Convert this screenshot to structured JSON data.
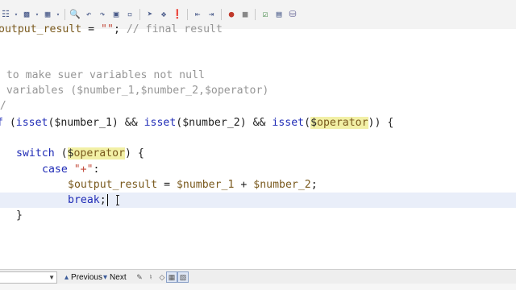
{
  "toolbar": {
    "icons": [
      "open-file-icon",
      "dropdown-icon",
      "save-icon",
      "dropdown-icon",
      "toggle-icon",
      "dropdown-icon",
      "find-icon",
      "find-previous-icon",
      "find-next-icon",
      "find-selection-icon",
      "toggle-bookmark-icon",
      "previous-bookmark-icon",
      "next-bookmark-icon",
      "shift-left-icon",
      "shift-right-icon",
      "start-macro-icon",
      "stop-macro-icon",
      "check-icon",
      "database-icon"
    ]
  },
  "code": {
    "line1": {
      "var": "output_result",
      "op": " = ",
      "str": "\"\"",
      "rest": "; ",
      "comment": "// final result"
    },
    "line3": "/*",
    "line4": " * to make suer variables not null",
    "line5": " * variables ($number_1,$number_2,$operator)",
    "line6": " */",
    "line8": {
      "kw1": "if",
      "p1": " (",
      "fn1": "isset",
      "a1": "($number_1)",
      "and1": " && ",
      "fn2": "isset",
      "a2": "($number_2)",
      "and2": " && ",
      "fn3": "isset",
      "a3o": "(",
      "a3d": "$",
      "a3v": "operator",
      "a3c": "))",
      "brace": " {"
    },
    "line10": {
      "kw": "switch",
      "o": " (",
      "d": "$",
      "v": "operator",
      "c": ") {"
    },
    "line11": {
      "kw": "case",
      "sp": " ",
      "str": "\"+\"",
      "c": ":"
    },
    "line12": {
      "lhs": "$output_result",
      "eq": " = ",
      "a": "$number_1",
      "plus": " + ",
      "b": "$number_2",
      "end": ";"
    },
    "line13": {
      "kw": "break",
      "end": ";"
    },
    "line14": "}"
  },
  "findbar": {
    "search_value": "",
    "previous_label": "Previous",
    "next_label": "Next"
  }
}
